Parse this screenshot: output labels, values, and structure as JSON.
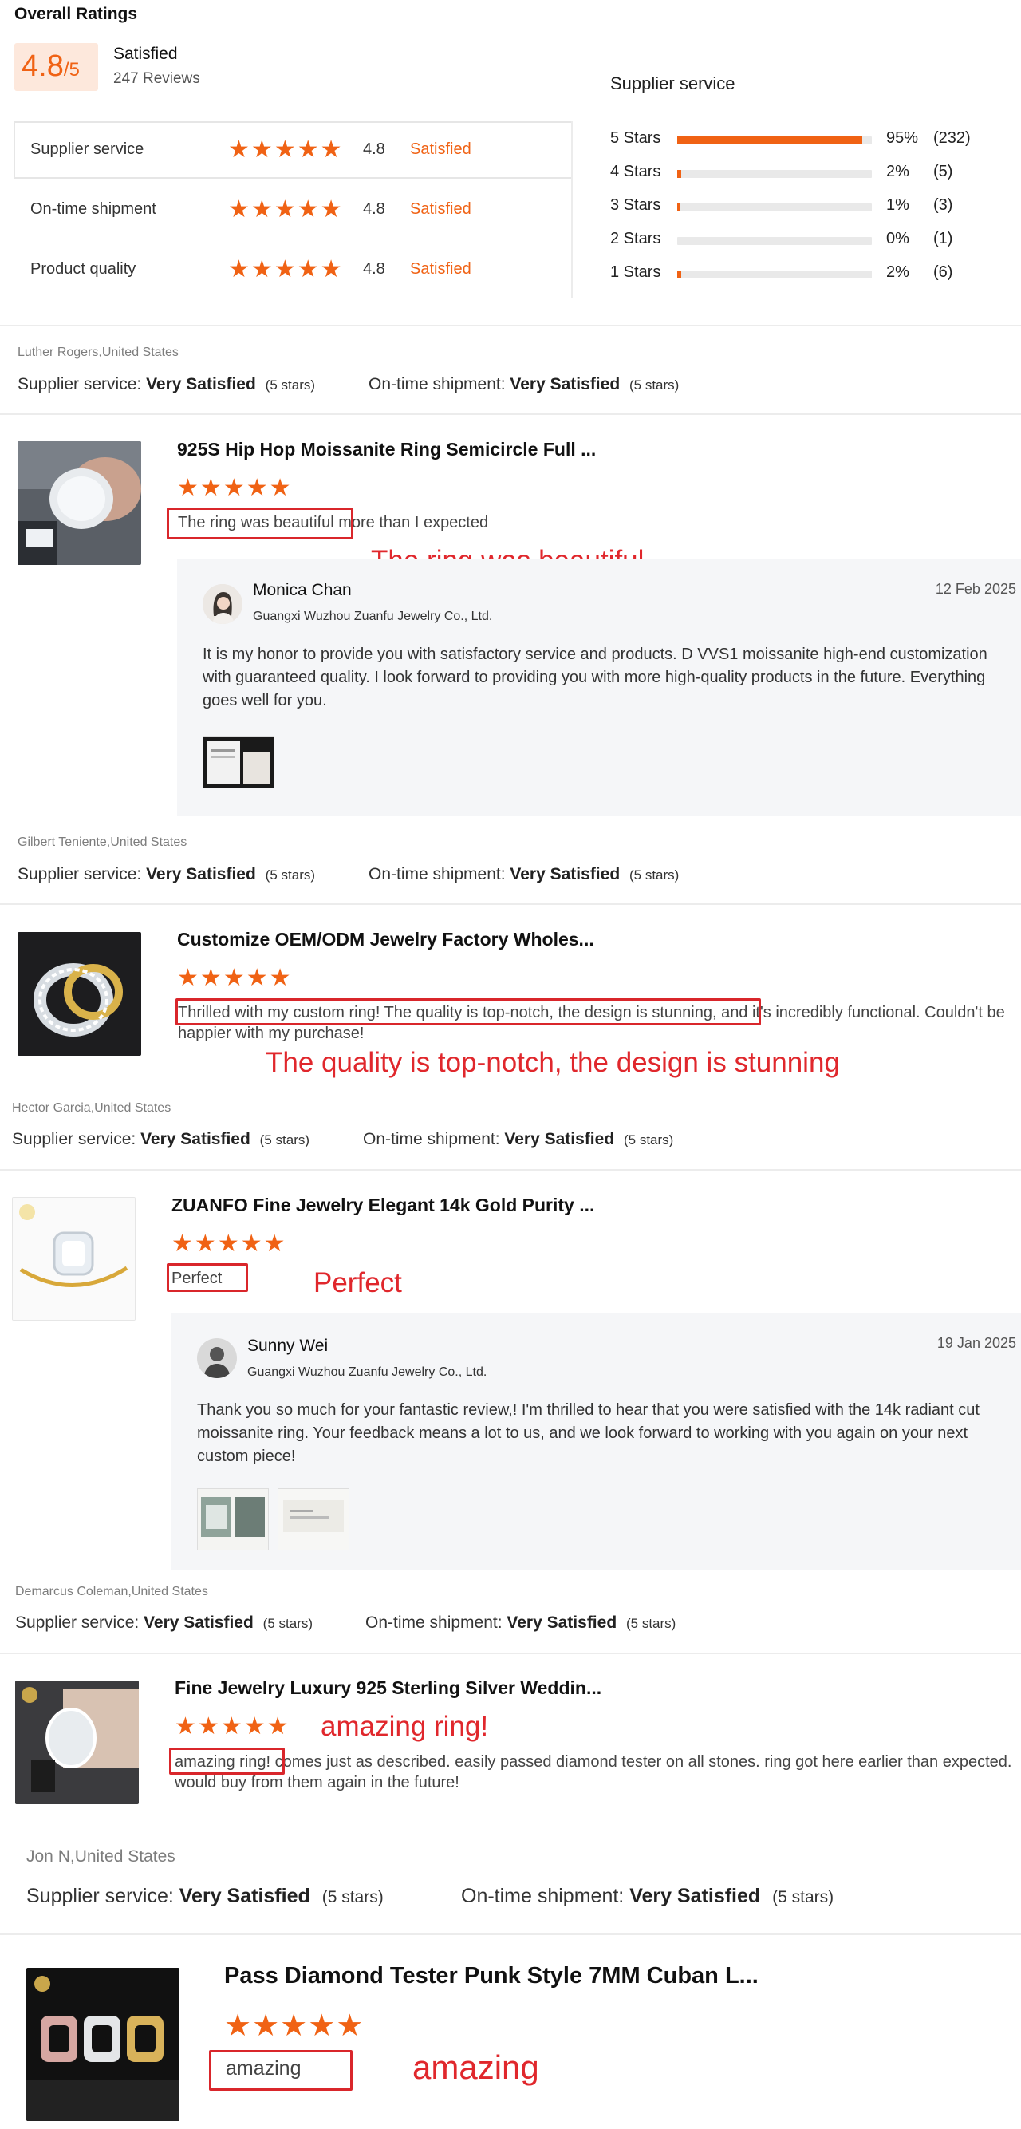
{
  "overall": {
    "heading": "Overall Ratings",
    "score": "4.8",
    "score_suffix": "/5",
    "label": "Satisfied",
    "reviews": "247 Reviews"
  },
  "categories": [
    {
      "name": "Supplier service",
      "score": "4.8",
      "label": "Satisfied"
    },
    {
      "name": "On-time shipment",
      "score": "4.8",
      "label": "Satisfied"
    },
    {
      "name": "Product quality",
      "score": "4.8",
      "label": "Satisfied"
    }
  ],
  "distribution": {
    "title": "Supplier service",
    "rows": [
      {
        "label": "5 Stars",
        "fraction": 0.95,
        "pct": "95%",
        "count": "(232)"
      },
      {
        "label": "4 Stars",
        "fraction": 0.02,
        "pct": "2%",
        "count": "(5)"
      },
      {
        "label": "3 Stars",
        "fraction": 0.01,
        "pct": "1%",
        "count": "(3)"
      },
      {
        "label": "2 Stars",
        "fraction": 0.0,
        "pct": "0%",
        "count": "(1)"
      },
      {
        "label": "1 Stars",
        "fraction": 0.02,
        "pct": "2%",
        "count": "(6)"
      }
    ]
  },
  "meta_labels": {
    "supplier_service": "Supplier service:",
    "on_time_shipment": "On-time shipment:",
    "very_satisfied": "Very Satisfied",
    "five_stars": "(5 stars)"
  },
  "reviews": [
    {
      "user": "Luther Rogers,United States",
      "product": "925S Hip Hop Moissanite Ring Semicircle Full ...",
      "text": "The ring was beautiful more than I expected",
      "note": "The ring was beautiful",
      "reply": {
        "name": "Monica Chan",
        "company": "Guangxi Wuzhou Zuanfu Jewelry Co., Ltd.",
        "date": "12 Feb 2025",
        "text": "It is my honor to provide you with satisfactory service and products. D VVS1 moissanite high-end customization with guaranteed quality. I look forward to providing you with more high-quality products in the future. Everything goes well for you."
      }
    },
    {
      "user": "Gilbert Teniente,United States",
      "product": "Customize OEM/ODM Jewelry Factory Wholes...",
      "text": "Thrilled with my custom ring! The quality is top-notch, the design is stunning, and it's incredibly functional. Couldn't be happier with my purchase!",
      "note": "The quality is top-notch, the design is stunning"
    },
    {
      "user": "Hector Garcia,United States",
      "product": "ZUANFO Fine Jewelry Elegant 14k Gold Purity ...",
      "text": "Perfect",
      "note": "Perfect",
      "reply": {
        "name": "Sunny Wei",
        "company": "Guangxi Wuzhou Zuanfu Jewelry Co., Ltd.",
        "date": "19 Jan 2025",
        "text": "Thank you so much for your fantastic review,! I'm thrilled to hear that you were satisfied with the 14k radiant cut moissanite ring. Your feedback means a lot to us, and we look forward to working with you again on your next custom piece!"
      }
    },
    {
      "user": "Demarcus Coleman,United States",
      "product": "Fine Jewelry Luxury 925 Sterling Silver Weddin...",
      "text": "amazing ring! comes just as described. easily passed diamond tester on all stones. ring got here earlier than expected. would buy from them again in the future!",
      "note": "amazing ring!"
    },
    {
      "user": "Jon N,United States",
      "product": "Pass Diamond Tester Punk Style 7MM Cuban L...",
      "text": "amazing",
      "note": "amazing"
    }
  ],
  "colors": {
    "accent": "#f06214",
    "annotation": "#e0272c"
  }
}
